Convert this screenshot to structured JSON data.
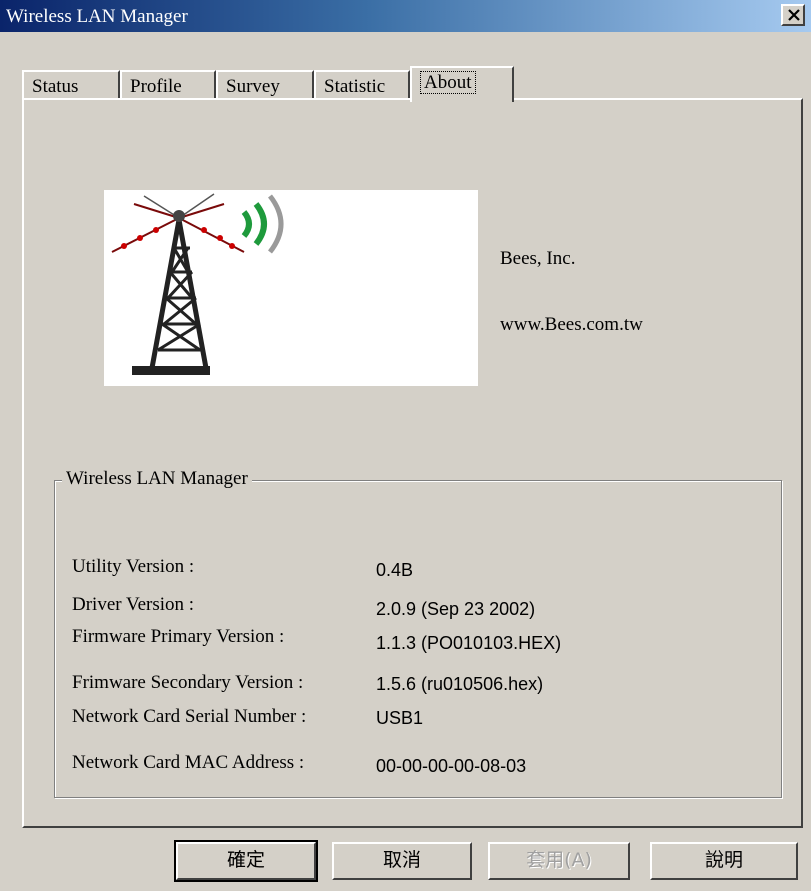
{
  "window": {
    "title": "Wireless LAN Manager",
    "close_label": "×"
  },
  "tabs": [
    {
      "label": "Status"
    },
    {
      "label": "Profile"
    },
    {
      "label": "Survey"
    },
    {
      "label": "Statistic"
    },
    {
      "label": "About",
      "active": true
    }
  ],
  "about": {
    "company": "Bees, Inc.",
    "website": "www.Bees.com.tw",
    "logo_icon": "radio-tower-icon"
  },
  "info": {
    "group_title": "Wireless LAN Manager",
    "rows": [
      {
        "label": "Utility Version :",
        "value": "0.4B"
      },
      {
        "label": "Driver Version :",
        "value": "2.0.9 (Sep 23 2002)"
      },
      {
        "label": "Firmware Primary Version :",
        "value": "1.1.3 (PO010103.HEX)"
      },
      {
        "label": "Frimware Secondary Version :",
        "value": "1.5.6 (ru010506.hex)"
      },
      {
        "label": "Network Card Serial Number :",
        "value": "USB1"
      },
      {
        "label": "Network Card MAC Address :",
        "value": "00-00-00-00-08-03"
      }
    ]
  },
  "buttons": {
    "ok": "確定",
    "cancel": "取消",
    "apply": "套用(A)",
    "help": "說明"
  },
  "colors": {
    "titlebar_start": "#0a246a",
    "dialog_bg": "#d4d0c8",
    "signal_green": "#1e9a3c"
  }
}
